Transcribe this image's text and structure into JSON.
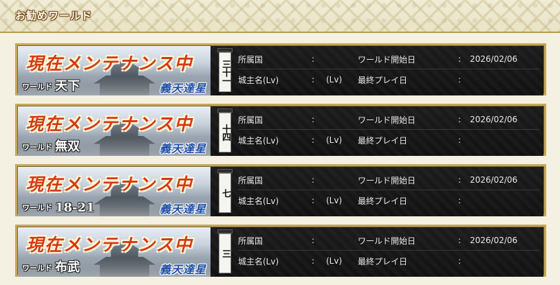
{
  "section": {
    "title": "お勧めワールド"
  },
  "labels": {
    "country": "所属国",
    "lord": "城主名(Lv)",
    "start_date": "ワールド開始日",
    "last_play": "最終プレイ日",
    "colon": ":",
    "lv_open": "(Lv)"
  },
  "worlds": [
    {
      "status": "現在メンテナンス中",
      "prefix": "ワールド",
      "name": "天下",
      "server": "義天達星",
      "number": "三十一",
      "start_date": "2026/02/06"
    },
    {
      "status": "現在メンテナンス中",
      "prefix": "ワールド",
      "name": "無双",
      "server": "義天達星",
      "number": "十四",
      "start_date": "2026/02/06"
    },
    {
      "status": "現在メンテナンス中",
      "prefix": "ワールド",
      "name": "18-21",
      "server": "義天達星",
      "number": "七",
      "start_date": "2026/02/06"
    },
    {
      "status": "現在メンテナンス中",
      "prefix": "ワールド",
      "name": "布武",
      "server": "義天達星",
      "number": "三",
      "start_date": "2026/02/06"
    }
  ],
  "colors": {
    "maintenance_text": "#d33a14",
    "server_text": "#1f4fa6",
    "frame_gold": "#c4a85a"
  }
}
